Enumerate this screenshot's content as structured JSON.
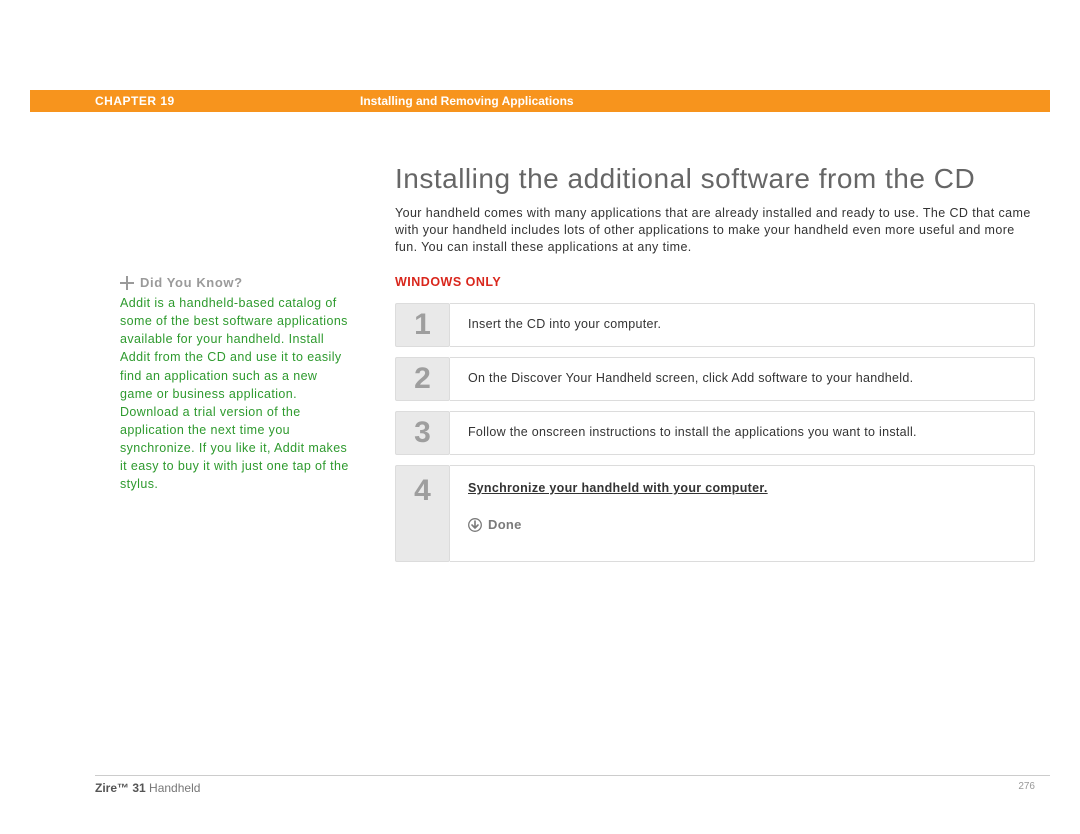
{
  "header": {
    "chapter": "CHAPTER 19",
    "title": "Installing and Removing Applications"
  },
  "main_title": "Installing the additional software from the CD",
  "intro": "Your handheld comes with many applications that are already installed and ready to use. The CD that came with your handheld includes lots of other applications to make your handheld even more useful and more fun. You can install these applications at any time.",
  "windows_only": "WINDOWS ONLY",
  "sidebar": {
    "heading": "Did You Know?",
    "body": "Addit is a handheld-based catalog of some of the best software applications available for your handheld. Install Addit from the CD and use it to easily find an application such as a new game or business application. Download a trial version of the application the next time you synchronize. If you like it, Addit makes it easy to buy it with just one tap of the stylus."
  },
  "steps": [
    {
      "num": "1",
      "text": "Insert the CD into your computer."
    },
    {
      "num": "2",
      "text": "On the Discover Your Handheld screen, click Add software to your handheld."
    },
    {
      "num": "3",
      "text": "Follow the onscreen instructions to install the applications you want to install."
    }
  ],
  "step4": {
    "num": "4",
    "sync_link": "Synchronize your handheld with your computer.",
    "done": "Done"
  },
  "footer": {
    "product_bold": "Zire™ 31",
    "product_rest": " Handheld",
    "page": "276"
  }
}
